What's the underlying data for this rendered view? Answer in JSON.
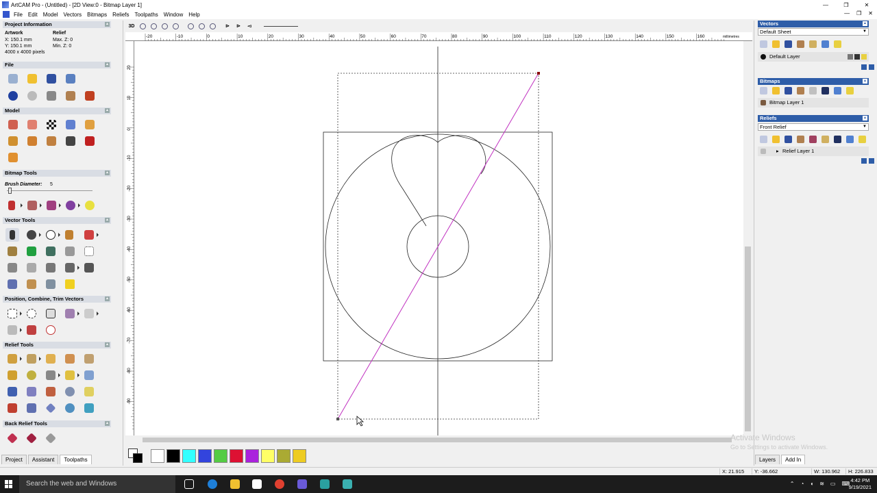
{
  "window": {
    "title": "ArtCAM Pro - (Untitled) - [2D View:0 - Bitmap Layer 1]",
    "min": "—",
    "restore": "❐",
    "close": "✕"
  },
  "menu": [
    "File",
    "Edit",
    "Model",
    "Vectors",
    "Bitmaps",
    "Reliefs",
    "Toolpaths",
    "Window",
    "Help"
  ],
  "menu_right": [
    "—",
    "❐",
    "✕"
  ],
  "project_info": {
    "header": "Project Information",
    "artwork_label": "Artwork",
    "relief_label": "Relief",
    "x": "X: 150.1 mm",
    "y": "Y: 150.1 mm",
    "pixels": "4000 x 4000 pixels",
    "maxz": "Max. Z: 0",
    "minz": "Min. Z: 0"
  },
  "sections": {
    "file": "File",
    "model": "Model",
    "bitmap_tools": "Bitmap Tools",
    "brush_label": "Brush Diameter:",
    "brush_value": "5",
    "vector_tools": "Vector Tools",
    "position": "Position, Combine, Trim Vectors",
    "relief_tools": "Relief Tools",
    "back_relief": "Back Relief Tools"
  },
  "left_tabs": [
    "Project",
    "Assistant",
    "Toolpaths"
  ],
  "toolbar": {
    "view3d": "3D"
  },
  "ruler": {
    "h_labels": [
      "-20",
      "-10",
      "0",
      "10",
      "20",
      "30",
      "40",
      "50",
      "60",
      "70",
      "80",
      "90",
      "100",
      "110",
      "120",
      "130",
      "140",
      "150",
      "160"
    ],
    "units": "millimetres",
    "v_labels": [
      "20",
      "10",
      "0",
      "-10",
      "-20",
      "-30",
      "-40",
      "-50",
      "-60",
      "-70",
      "-80",
      "-90"
    ]
  },
  "palette": {
    "colors": [
      "#ffffff",
      "#000000",
      "#33ffff",
      "#3344dd",
      "#55cc44",
      "#dd1133",
      "#aa22dd",
      "#ffff66",
      "#aaaa33",
      "#eecc22"
    ]
  },
  "right": {
    "vectors_header": "Vectors",
    "sheet": "Default Sheet",
    "default_layer": "Default Layer",
    "bitmaps_header": "Bitmaps",
    "bitmap_layer": "Bitmap Layer 1",
    "reliefs_header": "Reliefs",
    "relief_select": "Front Relief",
    "relief_layer": "Relief Layer 1"
  },
  "right_tabs": [
    "Layers",
    "Add In"
  ],
  "status": {
    "x": "X: 21.915",
    "y": "Y: -36.662",
    "w": "W: 130.962",
    "h": "H: 226.833"
  },
  "watermark": {
    "line1": "Activate Windows",
    "line2": "Go to Settings to activate Windows."
  },
  "taskbar": {
    "search": "Search the web and Windows",
    "time": "4:42 PM",
    "date": "9/19/2021"
  }
}
